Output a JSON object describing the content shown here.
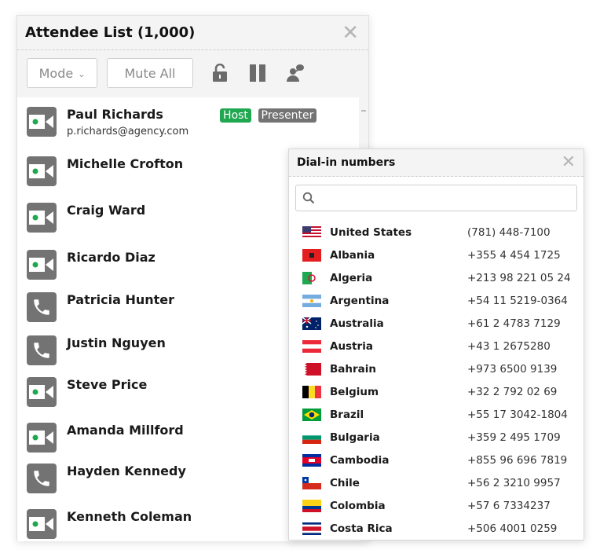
{
  "attendee_panel": {
    "title": "Attendee List (1,000)",
    "toolbar": {
      "mode_label": "Mode",
      "mute_all_label": "Mute All",
      "icons": [
        "lock-icon",
        "pause-icon",
        "speaker-request-icon"
      ]
    },
    "attendees": [
      {
        "name": "Paul Richards",
        "email": "p.richards@agency.com",
        "type": "video",
        "badges": [
          "Host",
          "Presenter"
        ]
      },
      {
        "name": "Michelle Crofton",
        "type": "video"
      },
      {
        "name": "Craig Ward",
        "type": "video"
      },
      {
        "name": "Ricardo Diaz",
        "type": "video"
      },
      {
        "name": "Patricia Hunter",
        "type": "phone"
      },
      {
        "name": "Justin Nguyen",
        "type": "phone"
      },
      {
        "name": "Steve Price",
        "type": "video"
      },
      {
        "name": "Amanda Millford",
        "type": "video"
      },
      {
        "name": "Hayden Kennedy",
        "type": "phone"
      },
      {
        "name": "Kenneth Coleman",
        "type": "video"
      }
    ],
    "colors": {
      "host_badge": "#1fa84f",
      "presenter_badge": "#737373",
      "video_dot": "#1fa84f"
    }
  },
  "dialin_panel": {
    "title": "Dial-in numbers",
    "search_placeholder": "",
    "countries": [
      {
        "name": "United States",
        "number": "(781) 448-7100"
      },
      {
        "name": "Albania",
        "number": "+355 4 454 1725"
      },
      {
        "name": "Algeria",
        "number": "+213 98 221 05 24"
      },
      {
        "name": "Argentina",
        "number": "+54 11 5219-0364"
      },
      {
        "name": "Australia",
        "number": "+61 2 4783 7129"
      },
      {
        "name": "Austria",
        "number": "+43 1 2675280"
      },
      {
        "name": "Bahrain",
        "number": "+973 6500 9139"
      },
      {
        "name": "Belgium",
        "number": "+32 2 792 02 69"
      },
      {
        "name": "Brazil",
        "number": "+55 17 3042-1804"
      },
      {
        "name": "Bulgaria",
        "number": "+359 2 495 1709"
      },
      {
        "name": "Cambodia",
        "number": "+855 96 696 7819"
      },
      {
        "name": "Chile",
        "number": "+56 2 3210 9957"
      },
      {
        "name": "Colombia",
        "number": "+57 6 7334237"
      },
      {
        "name": "Costa Rica",
        "number": "+506 4001 0259"
      }
    ]
  }
}
